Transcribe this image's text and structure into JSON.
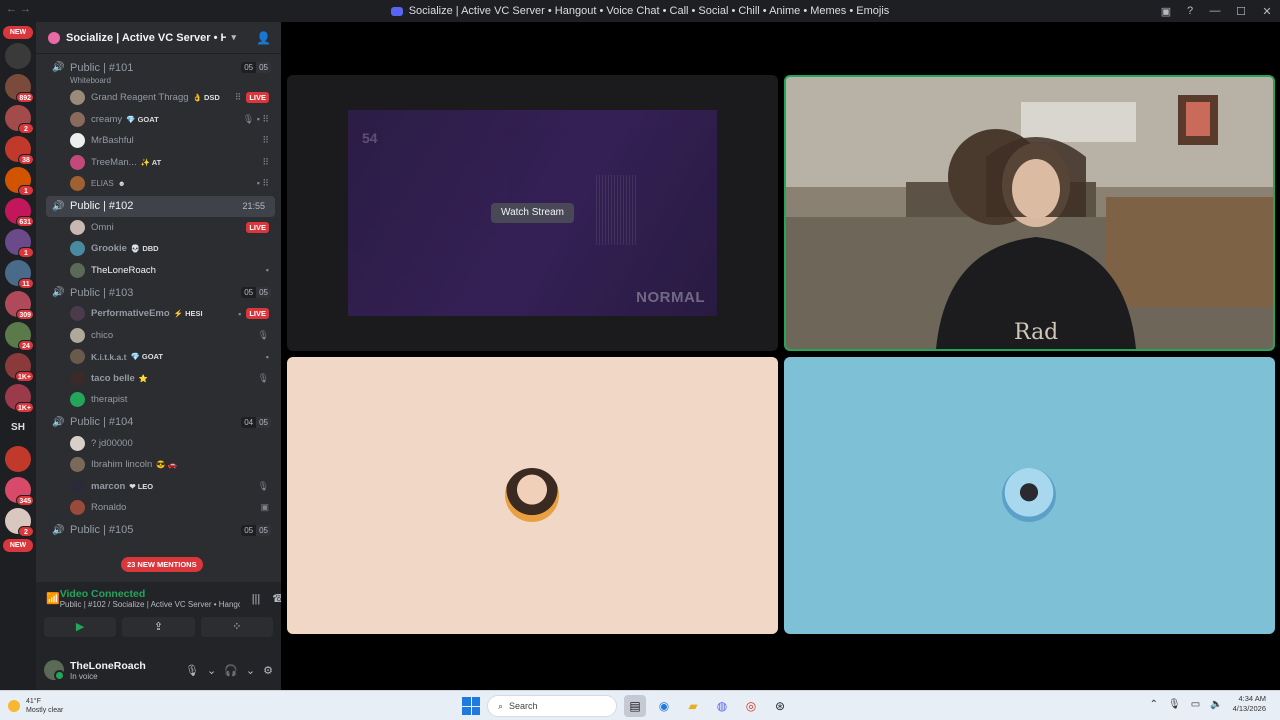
{
  "titlebar": {
    "title": "Socialize | Active VC Server • Hangout • Voice Chat • Call • Social • Chill • Anime • Memes • Emojis"
  },
  "rail": {
    "new_top": "NEW",
    "new_bottom": "NEW",
    "text_server": "SH",
    "badges": [
      "892",
      "2",
      "38",
      "1",
      "631",
      "1",
      "11",
      "309",
      "24",
      "1K+",
      "1K+",
      "345",
      "2"
    ]
  },
  "guild": {
    "name": "Socialize | Active VC Server • Han..."
  },
  "channels": [
    {
      "name": "Public | #101",
      "sub": "Whiteboard",
      "count_a": "05",
      "count_b": "05",
      "users": [
        {
          "name": "Grand Reagent Thragg",
          "tag": "👌 DSD",
          "live": "LIVE",
          "icons": "⠿"
        },
        {
          "name": "creamy",
          "tag": "💎 GOAT",
          "icons": "🎙 ▪ ⠿"
        },
        {
          "name": "MrBashful",
          "tag": "",
          "icons": "⠿"
        },
        {
          "name": "TreeMan...",
          "tag": "✨ AT",
          "icons": "⠿"
        },
        {
          "name": "ELIAS",
          "tag": "☻",
          "icons": "▪ ⠿"
        }
      ]
    },
    {
      "name": "Public | #102",
      "timer": "21:55",
      "users": [
        {
          "name": "Omni",
          "tag": "",
          "live": "LIVE"
        },
        {
          "name": "Grookie",
          "tag": "💀 DBD"
        },
        {
          "name": "TheLoneRoach",
          "tag": "",
          "icons": "▪"
        }
      ]
    },
    {
      "name": "Public | #103",
      "count_a": "05",
      "count_b": "05",
      "users": [
        {
          "name": "PerformativeEmo",
          "tag": "⚡ HESI",
          "live": "LIVE",
          "icons": "▪"
        },
        {
          "name": "chico",
          "tag": "",
          "icons": "🎙"
        },
        {
          "name": "K.i.t.k.a.t",
          "tag": "💎 GOAT",
          "icons": "▪"
        },
        {
          "name": "taco belle",
          "tag": "⭐",
          "icons": "🎙"
        },
        {
          "name": "therapist",
          "tag": ""
        }
      ]
    },
    {
      "name": "Public | #104",
      "count_a": "04",
      "count_b": "05",
      "users": [
        {
          "name": "? jd00000",
          "tag": ""
        },
        {
          "name": "Ibrahim lincoln",
          "tag": "😎 🚗"
        },
        {
          "name": "marcon",
          "tag": "❤ LEO",
          "icons": "🎙"
        },
        {
          "name": "Ronaldo",
          "tag": "",
          "icons": "▣"
        }
      ]
    },
    {
      "name": "Public | #105",
      "count_a": "05",
      "count_b": "05"
    }
  ],
  "mentions": "23 NEW MENTIONS",
  "voice": {
    "status": "Video Connected",
    "channel": "Public | #102 / Socialize | Active VC Server • Hango..."
  },
  "user_panel": {
    "name": "TheLoneRoach",
    "status": "In voice"
  },
  "stream": {
    "button": "Watch Stream",
    "number": "54",
    "overlay": "NORMAL"
  },
  "taskbar": {
    "temp": "41°F",
    "weather": "Mostly clear",
    "search": "Search",
    "time": "4:34 AM",
    "date": "4/13/2026"
  },
  "colors": {
    "accent_green": "#23a55a",
    "live_red": "#da373c",
    "sidebar_bg": "#2b2d31",
    "rail_bg": "#1e1f22"
  }
}
